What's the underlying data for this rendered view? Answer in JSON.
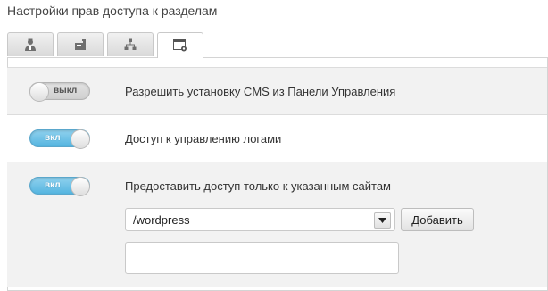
{
  "page": {
    "title": "Настройки прав доступа к разделам"
  },
  "tabs": [
    {
      "icon": "user-admin-icon",
      "active": false
    },
    {
      "icon": "mailbox-icon",
      "active": false
    },
    {
      "icon": "sitemap-icon",
      "active": false
    },
    {
      "icon": "window-settings-icon",
      "active": true
    }
  ],
  "settings": [
    {
      "toggle_label": "выкл",
      "state": "off",
      "text": "Разрешить установку CMS из Панели Управления"
    },
    {
      "toggle_label": "вкл",
      "state": "on",
      "text": "Доступ к управлению логами"
    },
    {
      "toggle_label": "вкл",
      "state": "on",
      "text": "Предоставить доступ только к указанным сайтам"
    }
  ],
  "site_form": {
    "selected_value": "/wordpress",
    "add_button_label": "Добавить",
    "sites_list_value": ""
  },
  "colors": {
    "toggle_on": "#55b5e0",
    "toggle_off": "#cfcfcf",
    "row_grey": "#f2f2f2"
  }
}
